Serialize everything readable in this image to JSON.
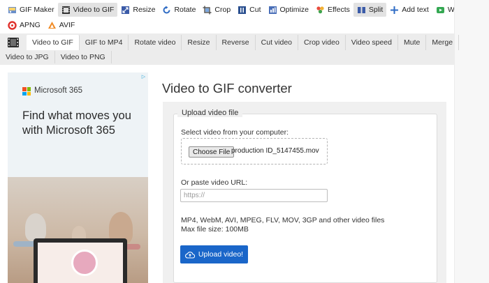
{
  "topnav": {
    "row1": [
      {
        "label": "GIF Maker",
        "icon": "gif-maker-icon",
        "active": false
      },
      {
        "label": "Video to GIF",
        "icon": "film-icon",
        "active": true
      },
      {
        "label": "Resize",
        "icon": "resize-icon",
        "active": false
      },
      {
        "label": "Rotate",
        "icon": "rotate-icon",
        "active": false
      },
      {
        "label": "Crop",
        "icon": "crop-icon",
        "active": false
      },
      {
        "label": "Cut",
        "icon": "cut-icon",
        "active": false
      },
      {
        "label": "Optimize",
        "icon": "optimize-icon",
        "active": false
      },
      {
        "label": "Effects",
        "icon": "effects-icon",
        "active": false
      },
      {
        "label": "Split",
        "icon": "split-icon",
        "active": true
      },
      {
        "label": "Add text",
        "icon": "add-text-icon",
        "active": false
      },
      {
        "label": "WebP",
        "icon": "webp-icon",
        "active": false
      }
    ],
    "row2": [
      {
        "label": "APNG",
        "icon": "apng-icon",
        "active": false
      },
      {
        "label": "AVIF",
        "icon": "avif-icon",
        "active": false
      }
    ]
  },
  "subnav": {
    "row1": [
      "Video to GIF",
      "GIF to MP4",
      "Rotate video",
      "Resize",
      "Reverse",
      "Cut video",
      "Crop video",
      "Video speed",
      "Mute",
      "Merge"
    ],
    "row2": [
      "Video to JPG",
      "Video to PNG"
    ],
    "active_index": 0
  },
  "ad": {
    "brand": "Microsoft 365",
    "headline": "Find what moves you with Microsoft 365"
  },
  "main": {
    "title": "Video to GIF converter",
    "legend": "Upload video file",
    "select_label": "Select video from your computer:",
    "choose_file_label": "Choose File",
    "file_name": "production ID_5147455.mov",
    "url_label": "Or paste video URL:",
    "url_placeholder": "https://",
    "formats_text": "MP4, WebM, AVI, MPEG, FLV, MOV, 3GP and other video files",
    "max_size_text": "Max file size: 100MB",
    "upload_button": "Upload video!"
  },
  "colors": {
    "accent": "#1a66c9",
    "subnav_bg": "#ececec",
    "panel_bg": "#f0f0f0"
  }
}
